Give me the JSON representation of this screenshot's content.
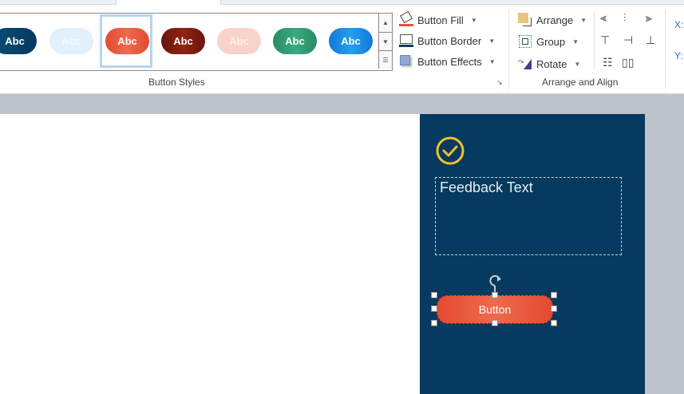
{
  "ribbon": {
    "gallery": {
      "items": [
        {
          "label": "Abc",
          "color": "#063a5f"
        },
        {
          "label": "Abc",
          "color": "#e1f0fd"
        },
        {
          "label": "Abc",
          "color": "#e8503a",
          "selected": true
        },
        {
          "label": "Abc",
          "color": "#7a1a10"
        },
        {
          "label": "Abc",
          "color": "#f8d3cc"
        },
        {
          "label": "Abc",
          "color": "#2f9a70"
        },
        {
          "label": "Abc",
          "color": "#1a8be8"
        }
      ]
    },
    "button_styles_label": "Button Styles",
    "button_fill": "Button Fill",
    "button_border": "Button Border",
    "button_effects": "Button Effects",
    "arrange": "Arrange",
    "group": "Group",
    "rotate": "Rotate",
    "arrange_align_label": "Arrange and Align",
    "x_label": "X:",
    "y_label": "Y:"
  },
  "slide": {
    "feedback_text": "Feedback Text",
    "button_label": "Button",
    "check_color": "#f2c12e",
    "background": "#063a5f"
  }
}
